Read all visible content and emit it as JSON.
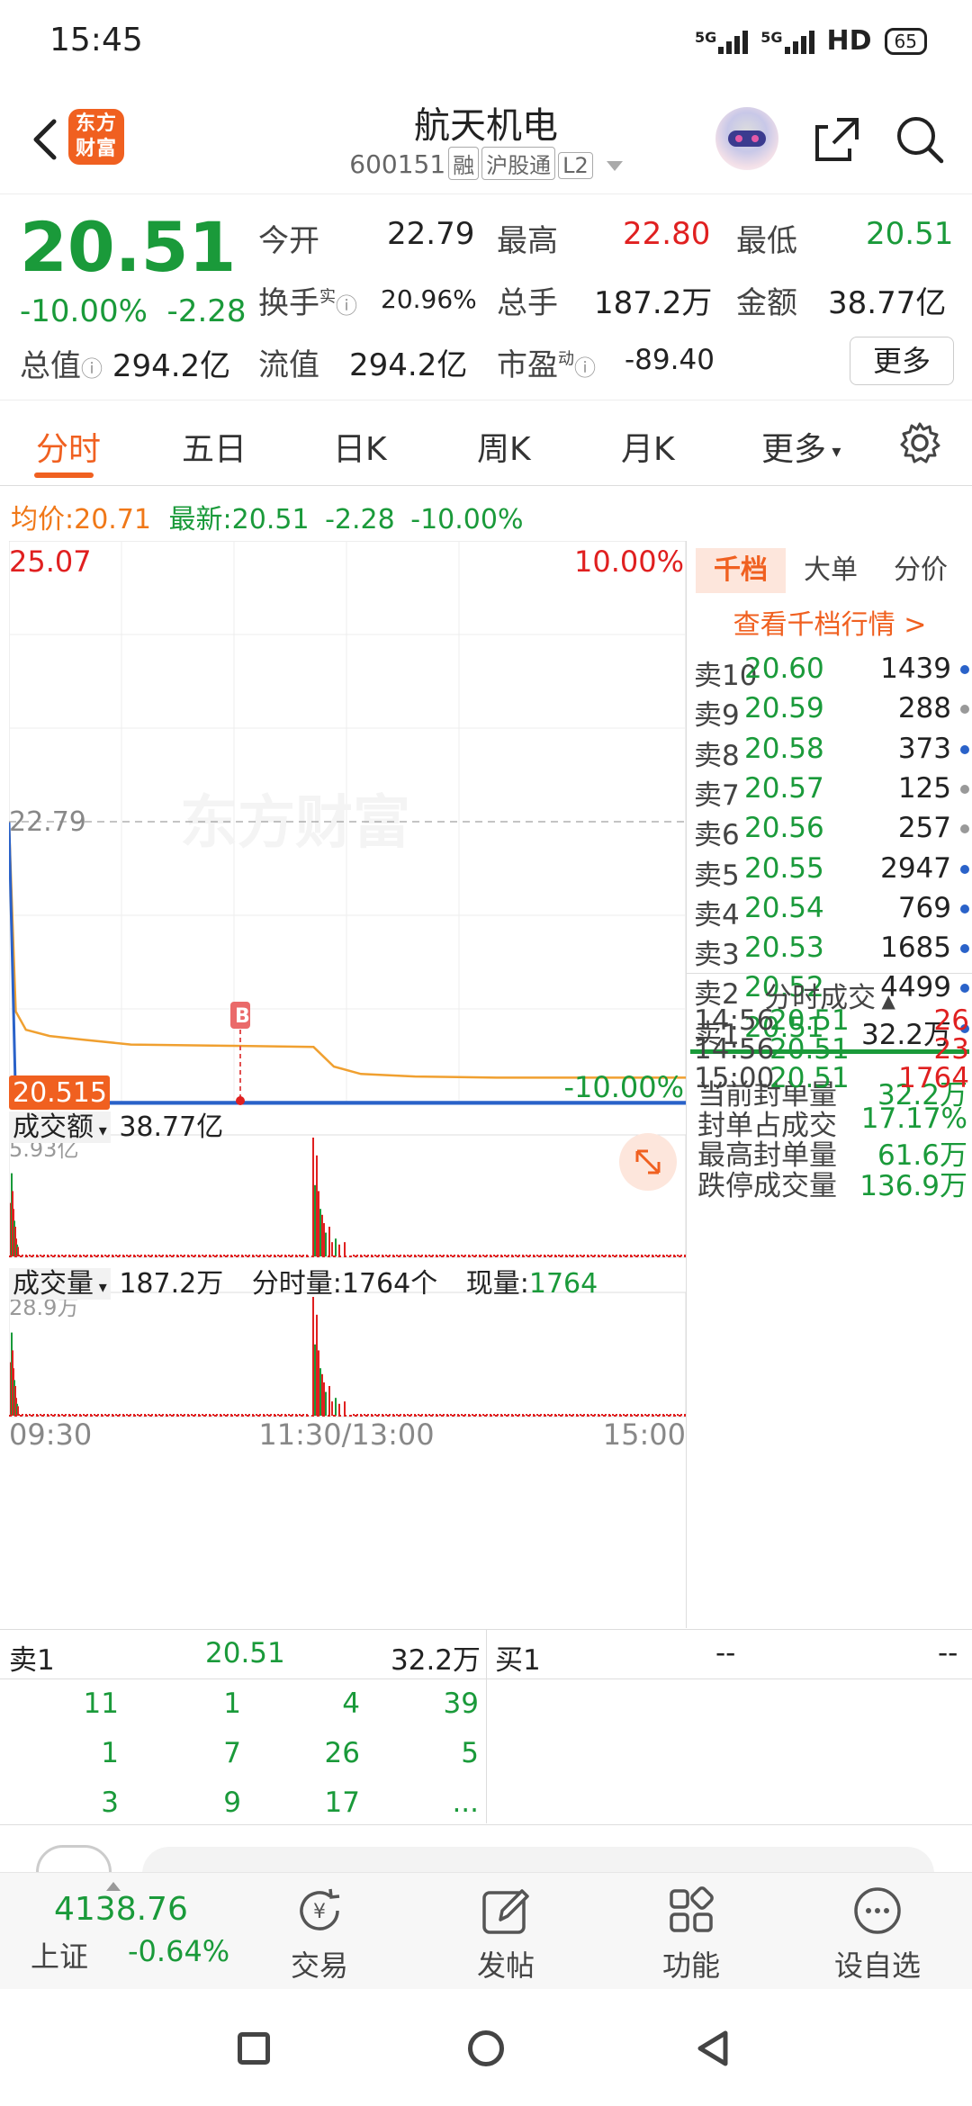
{
  "status": {
    "time": "15:45",
    "net1": "5G",
    "net2": "5G",
    "hd": "HD",
    "battery": "65"
  },
  "header": {
    "logo": "东方财富",
    "title": "航天机电",
    "code": "600151",
    "tags": [
      "融",
      "沪股通",
      "L2"
    ]
  },
  "quote": {
    "price": "20.51",
    "change_pct": "-10.00%",
    "change": "-2.28",
    "total_value_label": "总值",
    "total_value": "294.2亿",
    "open_label": "今开",
    "open": "22.79",
    "high_label": "最高",
    "high": "22.80",
    "low_label": "最低",
    "low": "20.51",
    "turnover_label": "换手",
    "turnover_sup": "实",
    "turnover": "20.96%",
    "volume_label": "总手",
    "volume": "187.2万",
    "amount_label": "金额",
    "amount": "38.77亿",
    "float_label": "流值",
    "float_value": "294.2亿",
    "pe_label": "市盈",
    "pe_sup": "动",
    "pe": "-89.40",
    "more": "更多"
  },
  "tabs": [
    "分时",
    "五日",
    "日K",
    "周K",
    "月K",
    "更多"
  ],
  "avg_bar": {
    "avg_label": "均价:",
    "avg": "20.71",
    "latest_label": "最新:",
    "latest": "20.51",
    "chg": "-2.28",
    "pct": "-10.00%"
  },
  "chart": {
    "y_top": "25.07",
    "pct_top": "10.00%",
    "open_ref": "22.79",
    "y_bottom": "20.515",
    "pct_bottom": "-10.00%",
    "marker": "B",
    "watermark": "东方财富",
    "amount_label": "成交额",
    "amount_value": "38.77亿",
    "amount_max": "5.93亿",
    "vol_label": "成交量",
    "vol_value": "187.2万",
    "min_vol_label": "分时量:",
    "min_vol": "1764个",
    "cur_vol_label": "现量:",
    "cur_vol": "1764",
    "vol_max": "28.9万",
    "x_labels": [
      "09:30",
      "11:30/13:00",
      "15:00"
    ]
  },
  "chart_data": {
    "type": "line",
    "title": "",
    "xlabel": "",
    "ylabel": "",
    "x": [
      "09:30",
      "09:31",
      "09:35",
      "09:45",
      "10:00",
      "10:30",
      "11:00",
      "11:30/13:00",
      "13:05",
      "13:10",
      "13:30",
      "14:00",
      "14:30",
      "15:00"
    ],
    "ylim": [
      20.515,
      25.07
    ],
    "series": [
      {
        "values": [
          22.79,
          21.25,
          21.1,
          21.05,
          21.02,
          20.98,
          20.97,
          20.96,
          20.8,
          20.74,
          20.72,
          20.71,
          20.71,
          20.71
        ]
      },
      {
        "values": [
          22.79,
          20.51,
          20.51,
          20.51,
          20.51,
          20.51,
          20.51,
          20.51,
          20.51,
          20.51,
          20.51,
          20.51,
          20.51,
          20.51
        ]
      }
    ],
    "grid": true
  },
  "orderbook": {
    "tabs": [
      "千档",
      "大单",
      "分价"
    ],
    "link": "查看千档行情 >",
    "asks": [
      {
        "label": "卖10",
        "price": "20.60",
        "vol": "1439",
        "dot": "#2a62c9"
      },
      {
        "label": "卖9",
        "price": "20.59",
        "vol": "288",
        "dot": "#999999"
      },
      {
        "label": "卖8",
        "price": "20.58",
        "vol": "373",
        "dot": "#2a62c9"
      },
      {
        "label": "卖7",
        "price": "20.57",
        "vol": "125",
        "dot": "#999999"
      },
      {
        "label": "卖6",
        "price": "20.56",
        "vol": "257",
        "dot": "#999999"
      },
      {
        "label": "卖5",
        "price": "20.55",
        "vol": "2947",
        "dot": "#2a62c9"
      },
      {
        "label": "卖4",
        "price": "20.54",
        "vol": "769",
        "dot": "#2a62c9"
      },
      {
        "label": "卖3",
        "price": "20.53",
        "vol": "1685",
        "dot": "#2a62c9"
      },
      {
        "label": "卖2",
        "price": "20.52",
        "vol": "4499",
        "dot": "#2a62c9"
      },
      {
        "label": "卖1",
        "price": "20.51",
        "vol": "32.2万",
        "dot": "#2a62c9"
      }
    ],
    "seal": [
      {
        "label": "当前封单量",
        "value": "32.2万"
      },
      {
        "label": "封单占成交",
        "value": "17.17%"
      },
      {
        "label": "最高封单量",
        "value": "61.6万"
      },
      {
        "label": "跌停成交量",
        "value": "136.9万"
      }
    ],
    "trades_title": "分时成交",
    "trades": [
      {
        "time": "14:56",
        "price": "20.51",
        "vol": "26"
      },
      {
        "time": "14:56",
        "price": "20.51",
        "vol": "23"
      },
      {
        "time": "15:00",
        "price": "20.51",
        "vol": "1764"
      }
    ]
  },
  "level1": {
    "sell_label": "卖1",
    "sell_price": "20.51",
    "sell_vol": "32.2万",
    "buy_label": "买1",
    "buy_price": "--",
    "buy_vol": "--",
    "queue": [
      [
        "11",
        "1",
        "4",
        "39"
      ],
      [
        "1",
        "7",
        "26",
        "5"
      ],
      [
        "3",
        "9",
        "17",
        "..."
      ]
    ]
  },
  "bottom_nav": {
    "index_value": "4138.76",
    "index_name": "上证",
    "index_pct": "-0.64%",
    "items": [
      "交易",
      "发帖",
      "功能",
      "设自选"
    ]
  }
}
